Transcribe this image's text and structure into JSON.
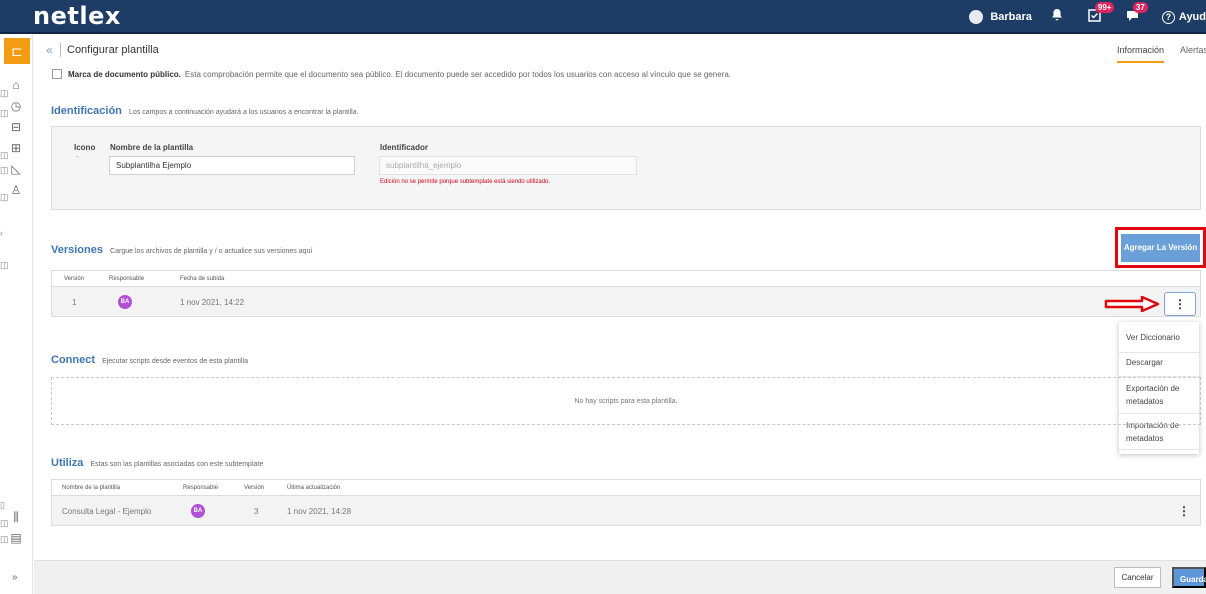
{
  "app": {
    "logo": "netlex"
  },
  "topbar": {
    "user_name": "Barbara",
    "tasks_badge": "99+",
    "messages_badge": "37",
    "help_label": "Ayud"
  },
  "header": {
    "title": "Configurar plantilla",
    "tabs": [
      "Información",
      "Alertas"
    ]
  },
  "public_mark": {
    "label": "Marca de documento público.",
    "description": "Esta comprobación permite que el documento sea público. El documento puede ser accedido por todos los usuarios con acceso al vínculo que se genera."
  },
  "identification": {
    "title": "Identificación",
    "description": "Los campos a continuación ayudará a los usuarios a encontrar la plantilla.",
    "icon_label": "Icono",
    "icon_value": "-",
    "name_label": "Nombre de la plantilla",
    "name_value": "Subplantilha Ejemplo",
    "id_label": "Identificador",
    "id_placeholder": "subplantilha_ejemplo",
    "id_error": "Edición no se permite porque subtemplate está siendo utilizado."
  },
  "versions": {
    "title": "Versiones",
    "description": "Cargue los archivos de plantilla y / o actualice sus versiones aquí",
    "add_button": "Agregar La Versión",
    "columns": [
      "Versión",
      "Responsable",
      "Fecha de subida"
    ],
    "rows": [
      {
        "version": "1",
        "owner_initials": "BA",
        "date": "1 nov 2021, 14:22"
      }
    ],
    "kebab": "⋮",
    "menu": [
      "Ver Diccionario",
      "Descargar",
      "Exportación de metadatos",
      "Importación de metadatos"
    ]
  },
  "connect": {
    "title": "Connect",
    "description": "Ejecutar scripts desde eventos de esta plantilla",
    "empty": "No hay scripts para esta plantilla."
  },
  "uses": {
    "title": "Utiliza",
    "description": "Estas son las plantillas asociadas con este subtemplate",
    "columns": [
      "Nombre de la plantilla",
      "Responsable",
      "Versión",
      "Última actualización"
    ],
    "rows": [
      {
        "name": "Consulta Legal - Ejemplo",
        "owner_initials": "BA",
        "version": "3",
        "updated": "1 nov 2021, 14:28"
      }
    ],
    "kebab": "⋮"
  },
  "footer": {
    "cancel": "Cancelar",
    "save": "Guarda"
  },
  "colors": {
    "topbar": "#1d3d66",
    "accent": "#f39c12",
    "link": "#3e76b4",
    "primary_button": "#6a9fd8",
    "highlight": "#e3060f",
    "avatar": "#b14fd6"
  }
}
